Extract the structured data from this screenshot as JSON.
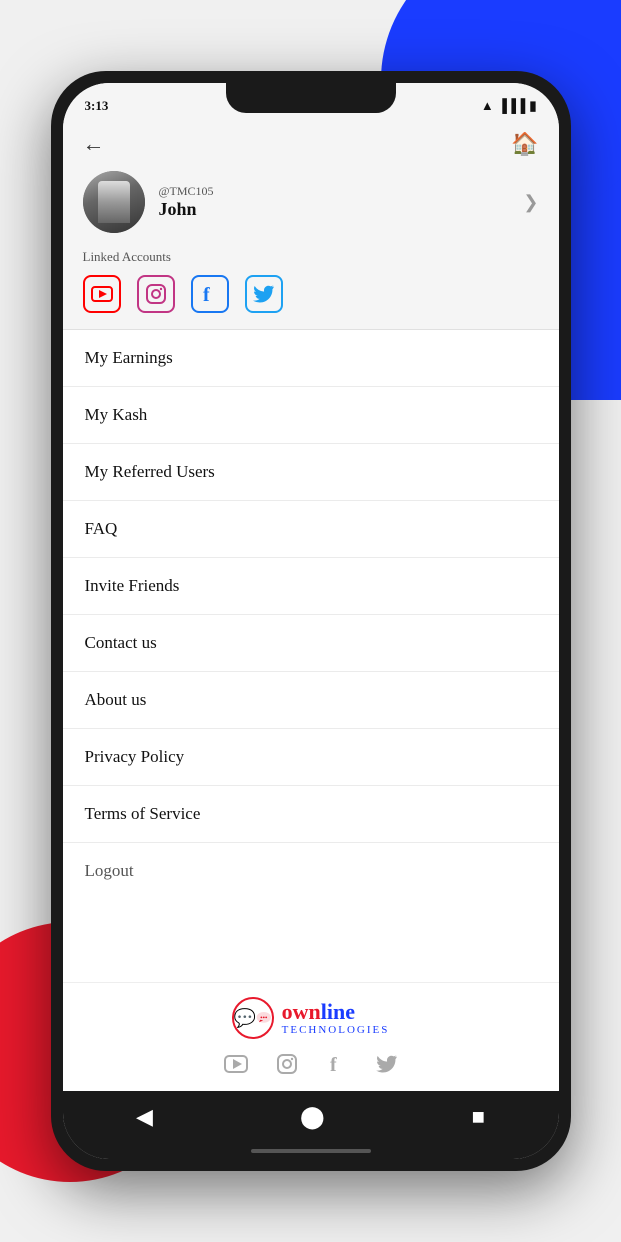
{
  "status": {
    "time": "3:13",
    "battery": "🔋",
    "signal": "📶"
  },
  "header": {
    "back_label": "←",
    "home_label": "🏠"
  },
  "profile": {
    "handle": "@TMC105",
    "name": "John",
    "arrow": "❯"
  },
  "linked": {
    "label": "Linked Accounts"
  },
  "menu": {
    "items": [
      "My Earnings",
      "My Kash",
      "My Referred Users",
      "FAQ",
      "Invite Friends",
      "Contact us",
      "About us",
      "Privacy Policy",
      "Terms of Service",
      "Logout"
    ]
  },
  "brand": {
    "own": "own",
    "line": "line",
    "tech": "technologies"
  },
  "nav": {
    "back": "◀",
    "home": "⬤",
    "square": "■"
  }
}
